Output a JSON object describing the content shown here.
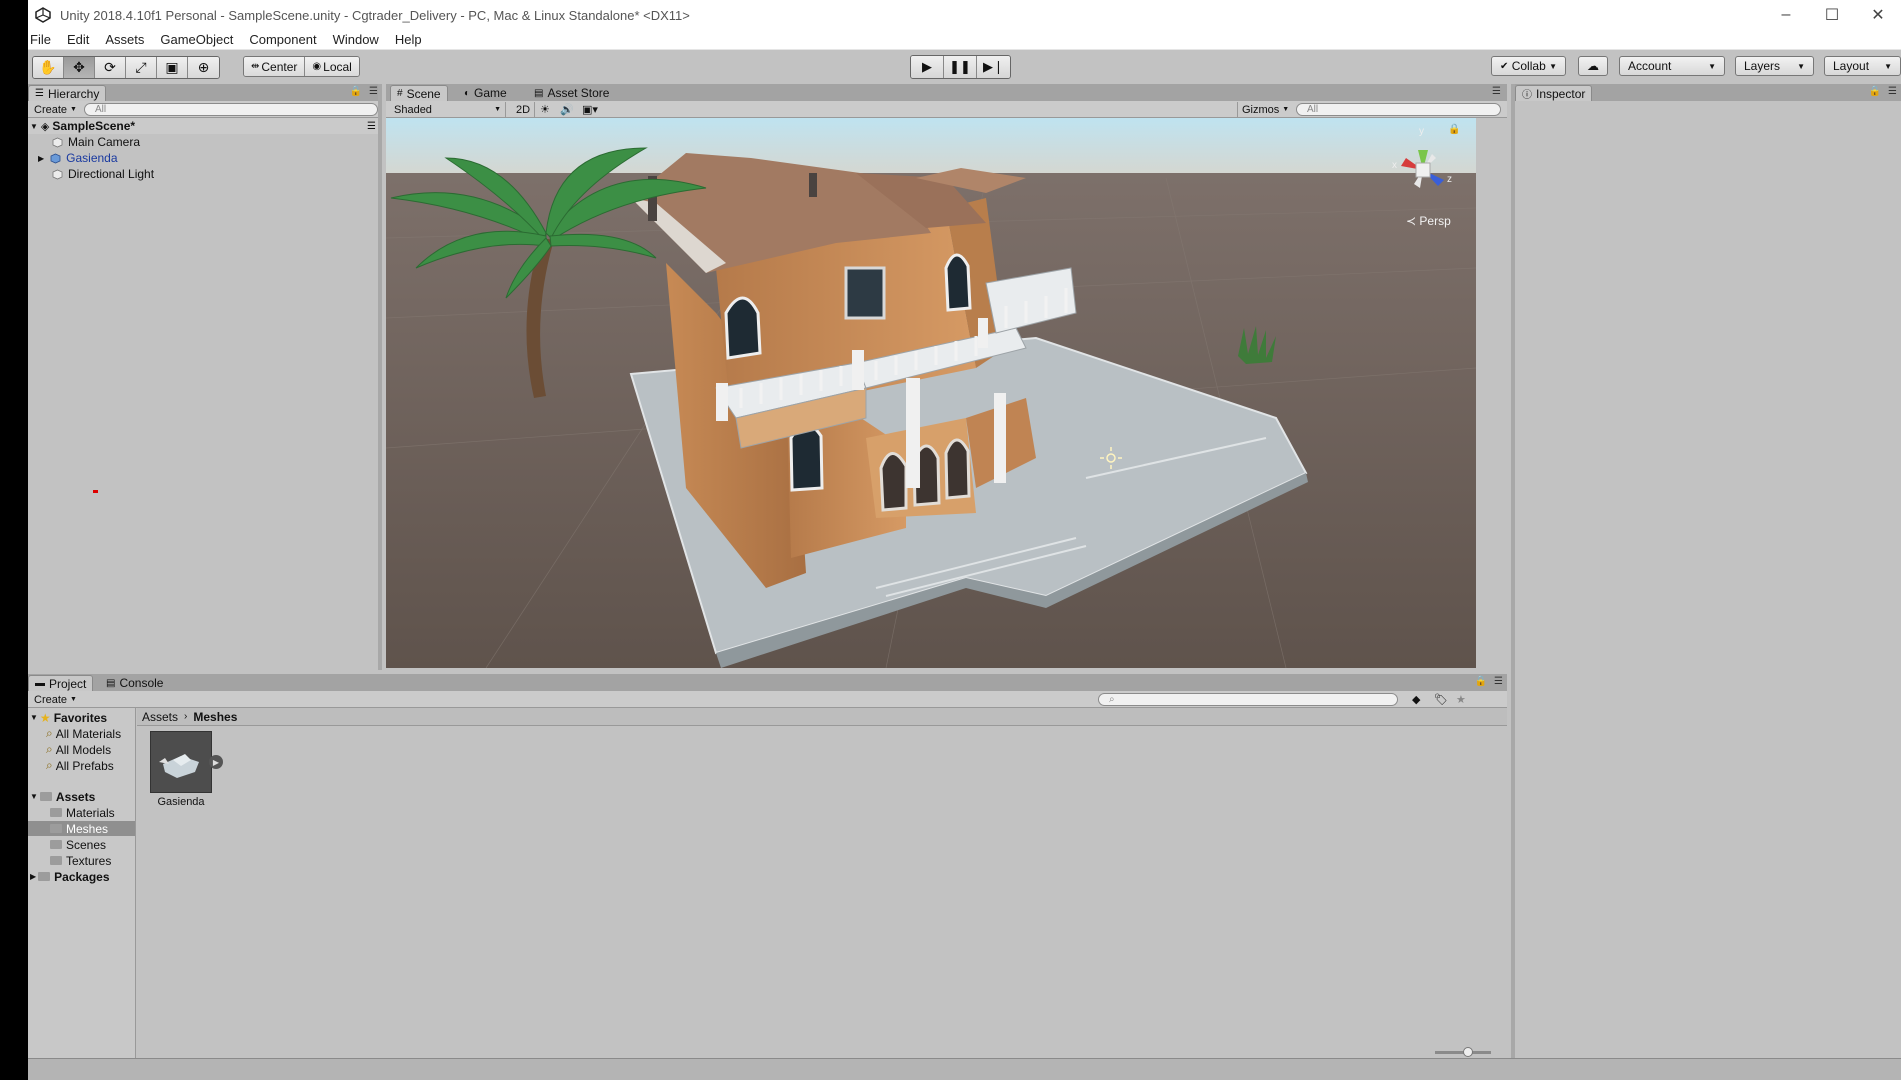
{
  "window": {
    "title": "Unity 2018.4.10f1 Personal - SampleScene.unity - Cgtrader_Delivery - PC, Mac & Linux Standalone* <DX11>",
    "minimize": "–",
    "maximize": "☐",
    "close": "✕"
  },
  "menu": [
    "File",
    "Edit",
    "Assets",
    "GameObject",
    "Component",
    "Window",
    "Help"
  ],
  "toolbar": {
    "pivot": "Center",
    "space": "Local",
    "collab": "Collab",
    "account": "Account",
    "layers": "Layers",
    "layout": "Layout"
  },
  "hierarchy": {
    "tab": "Hierarchy",
    "create": "Create",
    "search_placeholder": "All",
    "scene": "SampleScene*",
    "items": [
      "Main Camera",
      "Gasienda",
      "Directional Light"
    ]
  },
  "scene": {
    "tabs": [
      "Scene",
      "Game",
      "Asset Store"
    ],
    "shading": "Shaded",
    "mode_2d": "2D",
    "gizmos": "Gizmos",
    "search_placeholder": "All",
    "persp": "Persp",
    "axis_x": "x",
    "axis_y": "y",
    "axis_z": "z"
  },
  "inspector": {
    "tab": "Inspector"
  },
  "project": {
    "tabs": [
      "Project",
      "Console"
    ],
    "create": "Create",
    "favorites": "Favorites",
    "favorite_items": [
      "All Materials",
      "All Models",
      "All Prefabs"
    ],
    "assets": "Assets",
    "asset_folders": [
      "Materials",
      "Meshes",
      "Scenes",
      "Textures"
    ],
    "packages": "Packages",
    "breadcrumb": [
      "Assets",
      "Meshes"
    ],
    "asset_name": "Gasienda"
  },
  "colors": {
    "panel_bg": "#c2c2c2",
    "selection": "#8f8f8f",
    "prefab_text": "#1a3aa0",
    "ground": "#6b5f57",
    "sky": "#cfe6ef"
  }
}
